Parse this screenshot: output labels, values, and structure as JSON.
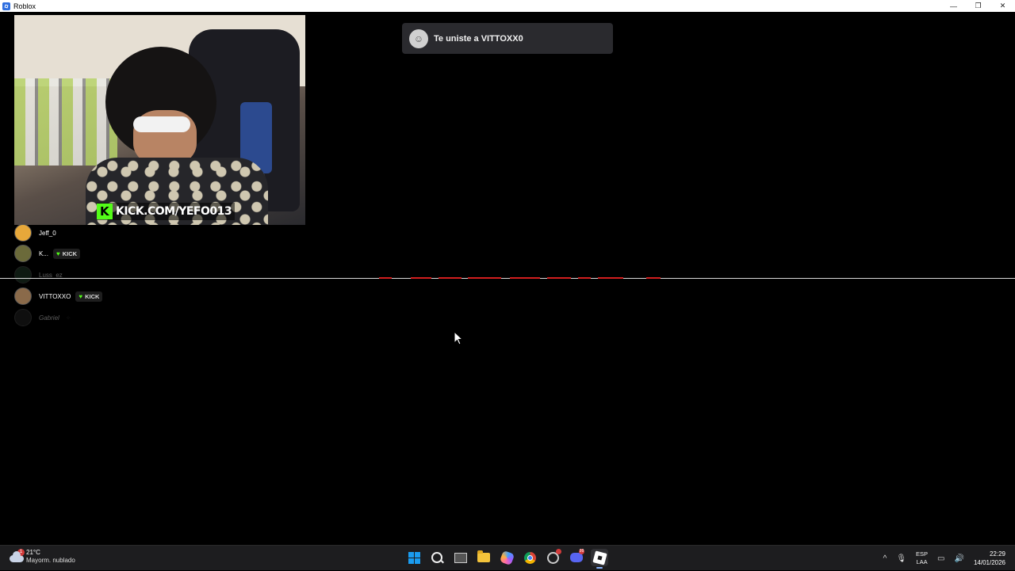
{
  "window": {
    "title": "Roblox",
    "minimize": "—",
    "maximize": "❐",
    "close": "✕"
  },
  "webcam": {
    "banner_text": "KICK.COM/YEFO013"
  },
  "players": [
    {
      "name": "Jeff_0",
      "badge": "",
      "avatar_color": "#e7a83a"
    },
    {
      "name": "K...",
      "badge": "KICK",
      "avatar_color": "#6b6a3a"
    },
    {
      "name": "Luss_ez",
      "badge": "",
      "avatar_color": "#2a4a36"
    },
    {
      "name": "VITTOXXO",
      "badge": "KICK",
      "avatar_color": "#8a6a4a"
    },
    {
      "name": "Gabriel",
      "badge": "",
      "avatar_color": "#2d2d2d"
    }
  ],
  "toast": {
    "message": "Te uniste a VITTOXX0"
  },
  "taskbar": {
    "weather": {
      "temp": "21°C",
      "condition": "Mayorm. nublado",
      "alert": "1"
    },
    "apps": [
      {
        "name": "start"
      },
      {
        "name": "search"
      },
      {
        "name": "task-view"
      },
      {
        "name": "file-explorer"
      },
      {
        "name": "copilot"
      },
      {
        "name": "chrome"
      },
      {
        "name": "obs"
      },
      {
        "name": "discord",
        "badge": "99"
      },
      {
        "name": "roblox",
        "active": true
      }
    ],
    "tray": {
      "chevron": "^",
      "mic": "🎙",
      "lang_top": "ESP",
      "lang_bottom": "LAA",
      "network": "▭",
      "volume": "🔊",
      "time": "22:29",
      "date": "14/01/2026"
    }
  }
}
